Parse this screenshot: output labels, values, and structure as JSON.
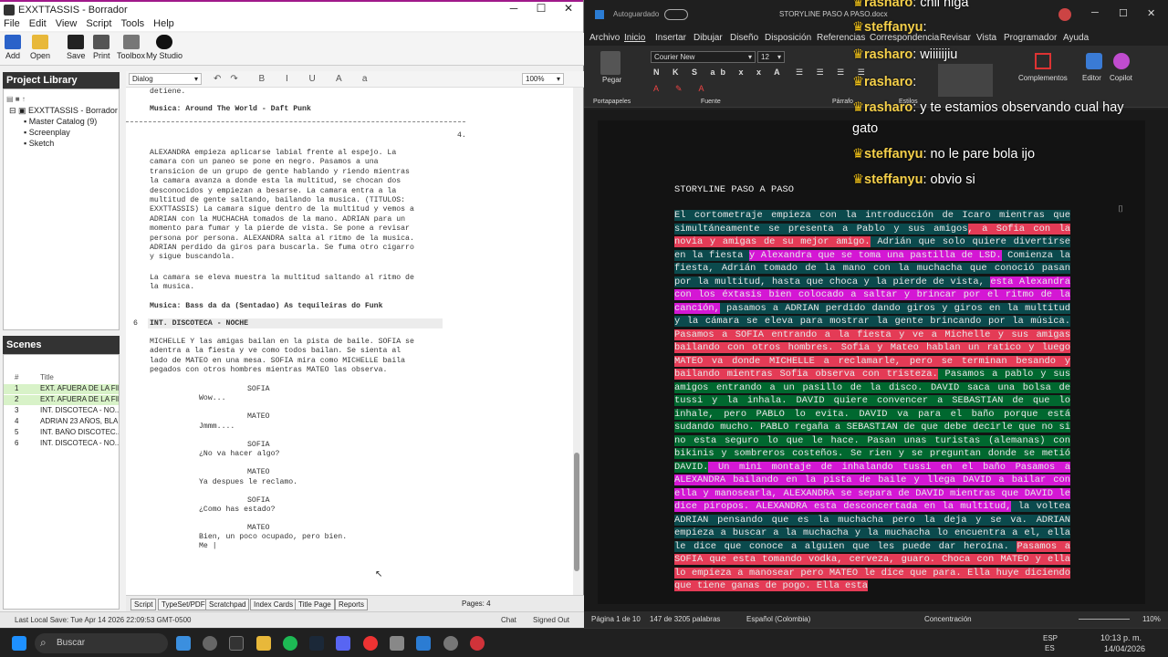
{
  "left_app": {
    "title": "EXXTTASSIS - Borrador",
    "menu": [
      "File",
      "Edit",
      "View",
      "Script",
      "Tools",
      "Help"
    ],
    "toolbar": {
      "add": "Add",
      "open": "Open",
      "save": "Save",
      "print": "Print",
      "toolbox": "Toolbox",
      "studio": "My Studio"
    },
    "library": {
      "header": "Project Library",
      "root": "EXXTTASSIS - Borrador",
      "items": [
        "Master Catalog (9)",
        "Screenplay",
        "Sketch"
      ]
    },
    "scenes": {
      "header": "Scenes",
      "col_num": "#",
      "col_title": "Title",
      "rows": [
        {
          "num": "1",
          "title": "EXT. AFUERA DE LA FIE..."
        },
        {
          "num": "2",
          "title": "EXT. AFUERA DE LA FIE..."
        },
        {
          "num": "3",
          "title": "INT. DISCOTECA - NO..."
        },
        {
          "num": "4",
          "title": "ADRIAN 23 AÑOS, BLA..."
        },
        {
          "num": "5",
          "title": "INT. BAÑO DISCOTEC..."
        },
        {
          "num": "6",
          "title": "INT. DISCOTECA - NO..."
        }
      ]
    },
    "editor": {
      "element_type": "Dialog",
      "zoom": "100%",
      "top_line": "detiene.",
      "music1": "Musica: Around The World - Daft Punk",
      "page_num": "4.",
      "action1": "ALEXANDRA empieza aplicarse labial frente al espejo. La\ncamara con un paneo se pone en negro. Pasamos a una\ntransicion de un grupo de gente hablando y riendo mientras\nla camara avanza a donde esta la multitud, se chocan dos\ndesconocidos y empiezan a besarse. La camara entra a la\nmultitud de gente saltando, bailando la musica. (TITULOS:\nEXXTTASSIS) La camara sigue dentro de la multitud y vemos a\nADRIAN con la MUCHACHA tomados de la mano. ADRIAN para un\nmomento para fumar y la pierde de vista. Se pone a revisar\npersona por persona. ALEXANDRA salta al ritmo de la musica.\nADRIAN perdido da giros para buscarla. Se fuma otro cigarro\ny sigue buscandola.",
      "action2": "La camara se eleva muestra la multitud saltando al ritmo de\nla musica.",
      "music2": "Musica: Bass da da (Sentadao) As tequileiras do Funk",
      "scene_num": "6",
      "scene_heading": "INT. DISCOTECA - NOCHE",
      "action3": "MICHELLE Y las amigas bailan en la pista de baile. SOFIA se\nadentra a la fiesta y ve como todos bailan. Se sienta al\nlado de MATEO en una mesa. SOFIA mira como MICHELLE baila\npegados con otros hombres mientras MATEO las observa.",
      "dialogue": [
        {
          "char": "SOFIA",
          "line": "Wow..."
        },
        {
          "char": "MATEO",
          "line": "Jmmm...."
        },
        {
          "char": "SOFIA",
          "line": "¿No va hacer algo?"
        },
        {
          "char": "MATEO",
          "line": "Ya despues le reclamo."
        },
        {
          "char": "SOFIA",
          "line": "¿Como has estado?"
        },
        {
          "char": "MATEO",
          "line": "Bien, un poco ocupado, pero bien."
        }
      ],
      "typing": "Me |"
    },
    "tabs": [
      "Script",
      "TypeSet/PDF",
      "Scratchpad",
      "Index Cards",
      "Title Page",
      "Reports"
    ],
    "pages": "Pages: 4",
    "last_save": "Last Local Save: Tue Apr 14 2026 22:09:53 GMT-0500",
    "chat": "Chat",
    "signed": "Signed Out"
  },
  "right_app": {
    "autosave": "Autoguardado",
    "doc_title": "STORYLINE PASO A PASO.docx",
    "menu": [
      "Archivo",
      "Inicio",
      "Insertar",
      "Dibujar",
      "Diseño",
      "Disposición",
      "Referencias",
      "Correspondencia",
      "Revisar",
      "Vista",
      "Programador",
      "Ayuda"
    ],
    "ribbon": {
      "paste": "Pegar",
      "font": "Courier New",
      "size": "12",
      "clipboard": "Portapapeles",
      "font_group": "Fuente",
      "paragraph": "Párrafo",
      "styles": "Estilos",
      "complements": "Complementos",
      "editor": "Editor",
      "copilot": "Copilot"
    },
    "doc_heading": "STORYLINE PASO A PASO",
    "doc_segments": [
      {
        "c": "t",
        "t": "El cortometraje empieza con la introducción de Icaro mientras que simultáneamente se presenta a Pablo y sus amigos"
      },
      {
        "c": "r",
        "t": ", a Sofia con la novia y amigas de su mejor amigo."
      },
      {
        "c": "t",
        "t": " Adrián que solo quiere divertirse en la fiesta "
      },
      {
        "c": "m",
        "t": "y Alexandra que se toma una pastilla de LSD."
      },
      {
        "c": "t",
        "t": " Comienza la fiesta, Adrián tomado de la mano con la muchacha que conoció pasan por la multitud, hasta que choca y la pierde de vista, "
      },
      {
        "c": "m",
        "t": "esta Alexandra con los éxtasis bien colocado a saltar y brincar por el ritmo de la canción,"
      },
      {
        "c": "t",
        "t": " pasamos a ADRIAN perdido dando giros y giros en la multitud y la cámara se eleva para mostrar la gente brincando por la música. "
      },
      {
        "c": "r",
        "t": "Pasamos a SOFIA entrando a la fiesta y ve a Michelle y sus amigas bailando con otros hombres. Sofia y Mateo hablan un ratico y luego MATEO va donde MICHELLE a reclamarle, pero se terminan besando y bailando mientras Sofia observa con tristeza."
      },
      {
        "c": "g",
        "t": " Pasamos a pablo y sus amigos entrando a un pasillo de la disco. DAVID saca una bolsa de tussi y la inhala. DAVID quiere convencer a SEBASTIAN de que lo inhale, pero PABLO lo evita. DAVID va para el baño porque está sudando mucho. PABLO regaña a SEBASTIAN de que debe decirle que no si no esta seguro lo que le hace. Pasan unas turistas (alemanas) con bikinis y sombreros costeños. Se rien y se preguntan donde se metió DAVID."
      },
      {
        "c": "m",
        "t": " Un mini montaje de inhalando tussi en el baño Pasamos a ALEXANDRA bailando en la pista de baile y llega DAVID a bailar con ella y manosearla, ALEXANDRA se separa de DAVID mientras que DAVID le dice piropos. ALEXANDRA esta desconcertada en la multitud,"
      },
      {
        "c": "t",
        "t": " la voltea ADRIAN pensando que es la muchacha pero la deja y se va. ADRIAN empieza a buscar a la muchacha y la muchacha lo encuentra a el, ella le dice que conoce a alguien que les puede dar heroína. "
      },
      {
        "c": "r",
        "t": "Pasamos a SOFIA que esta tomando vodka, cerveza, guaro. Choca con MATEO y ella lo empieza a manosear pero MATEO le dice que para. Ella huye diciendo que tiene ganas de pogo. Ella esta"
      }
    ],
    "status": {
      "page": "Página 1 de 10",
      "words": "147 de 3205 palabras",
      "lang": "Español (Colombia)",
      "focus": "Concentración",
      "zoom": "110%"
    }
  },
  "chat_overlay": [
    {
      "user": "rasharo",
      "msg": "chil niga"
    },
    {
      "user": "steffanyu",
      "msg": ""
    },
    {
      "user": "rasharo",
      "msg": "wiiiiijiu"
    },
    {
      "user": "rasharo",
      "msg": ""
    },
    {
      "user": "rasharo",
      "msg": "y te estamios observando cual hay"
    },
    {
      "user": "",
      "msg": "gato"
    },
    {
      "user": "steffanyu",
      "msg": "no le pare bola ijo"
    },
    {
      "user": "steffanyu",
      "msg": "obvio si"
    }
  ],
  "taskbar": {
    "search": "Buscar",
    "lang": "ESP",
    "lang2": "ES",
    "time": "10:13 p. m.",
    "date": "14/04/2026"
  }
}
